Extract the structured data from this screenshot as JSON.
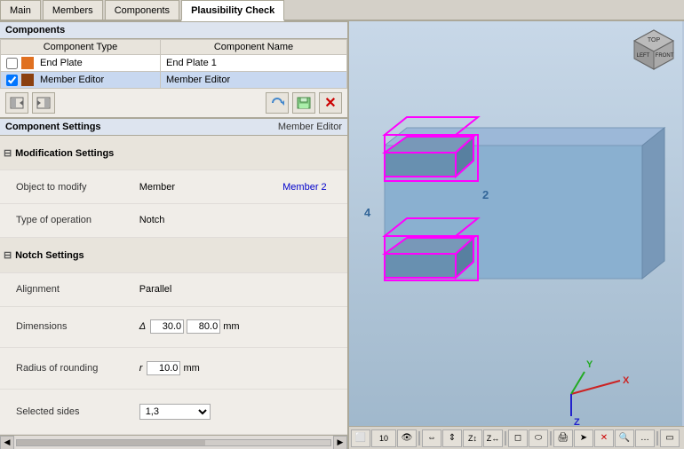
{
  "tabs": [
    {
      "label": "Main",
      "active": false
    },
    {
      "label": "Members",
      "active": false
    },
    {
      "label": "Components",
      "active": false
    },
    {
      "label": "Plausibility Check",
      "active": true
    }
  ],
  "components_section": {
    "title": "Components",
    "columns": [
      "Component Type",
      "Component Name"
    ],
    "rows": [
      {
        "checkbox": false,
        "icon": "orange",
        "type": "End Plate",
        "name": "End Plate 1",
        "selected": false
      },
      {
        "checkbox": true,
        "icon": "brown",
        "type": "Member Editor",
        "name": "Member Editor",
        "selected": true
      }
    ]
  },
  "toolbar": {
    "buttons": [
      "move_left",
      "move_right",
      "recycle",
      "save",
      "delete"
    ]
  },
  "component_settings": {
    "title": "Component Settings",
    "subtitle": "Member Editor",
    "groups": [
      {
        "label": "Modification Settings",
        "expanded": true,
        "rows": [
          {
            "name": "Object to modify",
            "value": "Member",
            "value2": "Member 2"
          },
          {
            "name": "Type of operation",
            "value": "Notch",
            "value2": ""
          }
        ]
      },
      {
        "label": "Notch Settings",
        "expanded": true,
        "rows": [
          {
            "name": "Alignment",
            "value": "Parallel",
            "delta": false,
            "r": false,
            "v1": "",
            "v2": "",
            "unit": ""
          },
          {
            "name": "Dimensions",
            "value": "",
            "delta": true,
            "r": false,
            "v1": "30.0",
            "v2": "80.0",
            "unit": "mm"
          },
          {
            "name": "Radius of rounding",
            "value": "",
            "delta": false,
            "r": true,
            "v1": "",
            "v2": "10.0",
            "unit": "mm"
          },
          {
            "name": "Selected sides",
            "value": "1,3",
            "delta": false,
            "r": false,
            "v1": "",
            "v2": "",
            "unit": "",
            "dropdown": true
          }
        ]
      }
    ]
  },
  "view_toolbar_buttons": [
    "frame",
    "10",
    "eye",
    "arrows_h",
    "arrows_v",
    "layer_z",
    "z_layer2",
    "box",
    "cylinder",
    "print",
    "arrow_right",
    "cursor",
    "zoom",
    "more",
    "square"
  ],
  "badges": [
    "4",
    "2"
  ],
  "axis": {
    "x": "X",
    "y": "Y",
    "z": "Z"
  },
  "colors": {
    "bg_panel": "#f0ede8",
    "bg_header": "#dde4ef",
    "bg_table_header": "#e8e4dc",
    "accent": "#c8d8f0",
    "viewport": "#a8b8cc"
  }
}
